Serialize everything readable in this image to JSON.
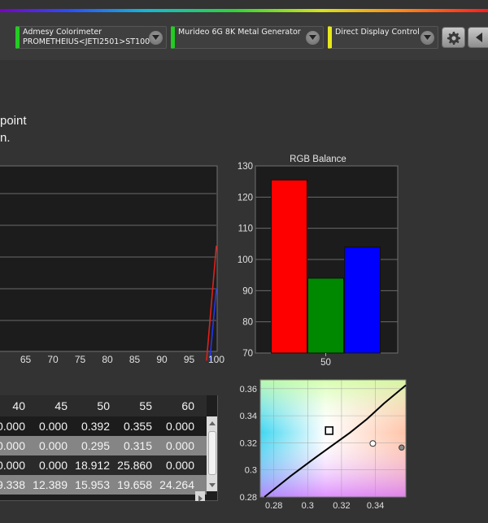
{
  "toolbar": {
    "devices": [
      {
        "line1": "Admesy Colorimeter",
        "line2": "PROMETHEIUS<JETI2501>ST100",
        "status_color": "#22cc22"
      },
      {
        "line1": "Murideo 6G 8K Metal Generator",
        "line2": "",
        "status_color": "#22cc22"
      },
      {
        "line1": "Direct Display Control",
        "line2": "",
        "status_color": "#e8e81a"
      }
    ],
    "buttons": [
      "gear-icon",
      "back-arrow-icon"
    ]
  },
  "instructions": {
    "line1": "point",
    "line2": "n."
  },
  "chart_data": [
    {
      "type": "line",
      "x_tick_labels": [
        "65",
        "70",
        "75",
        "80",
        "85",
        "90",
        "95",
        "100"
      ],
      "xlim": [
        60,
        100
      ],
      "grid": true,
      "series": [
        {
          "color": "#e0201c",
          "x": [
            98.2,
            100
          ],
          "y": [
            -0.05,
            0.57
          ]
        },
        {
          "color": "#2538e8",
          "x": [
            98.8,
            100
          ],
          "y": [
            -0.05,
            0.34
          ]
        }
      ]
    },
    {
      "type": "bar",
      "title": "RGB Balance",
      "categories": [
        "50"
      ],
      "series": [
        {
          "color": "#ff0000",
          "values": [
            125.5
          ]
        },
        {
          "color": "#008800",
          "values": [
            94
          ]
        },
        {
          "color": "#0000ff",
          "values": [
            104
          ]
        }
      ],
      "ylim": [
        70,
        130
      ],
      "y_ticks": [
        "70",
        "80",
        "90",
        "100",
        "110",
        "120",
        "130"
      ],
      "grid": true
    },
    {
      "type": "scatter",
      "x_ticks": [
        "0.28",
        "0.3",
        "0.32",
        "0.34"
      ],
      "y_ticks": [
        "0.28",
        "0.3",
        "0.32",
        "0.34",
        "0.36"
      ],
      "xlim": [
        0.272,
        0.358
      ],
      "ylim": [
        0.28,
        0.3665
      ],
      "points": [
        {
          "x": 0.3127,
          "y": 0.329,
          "marker": "target-square"
        },
        {
          "x": 0.3385,
          "y": 0.3195,
          "marker": "white-dot"
        },
        {
          "x": 0.3555,
          "y": 0.3165,
          "marker": "gray-dot"
        }
      ],
      "curve": [
        [
          0.2745,
          0.28
        ],
        [
          0.29,
          0.2955
        ],
        [
          0.305,
          0.3095
        ],
        [
          0.315,
          0.3185
        ],
        [
          0.325,
          0.3275
        ],
        [
          0.335,
          0.3375
        ],
        [
          0.345,
          0.349
        ],
        [
          0.358,
          0.3625
        ]
      ]
    }
  ],
  "table": {
    "headers": [
      "40",
      "45",
      "50",
      "55",
      "60"
    ],
    "rows": [
      [
        "0.000",
        "0.000",
        "0.392",
        "0.355",
        "0.000"
      ],
      [
        "0.000",
        "0.000",
        "0.295",
        "0.315",
        "0.000"
      ],
      [
        "0.000",
        "0.000",
        "18.912",
        "25.860",
        "0.000"
      ],
      [
        "9.338",
        "12.389",
        "15.953",
        "19.658",
        "24.264"
      ]
    ]
  }
}
